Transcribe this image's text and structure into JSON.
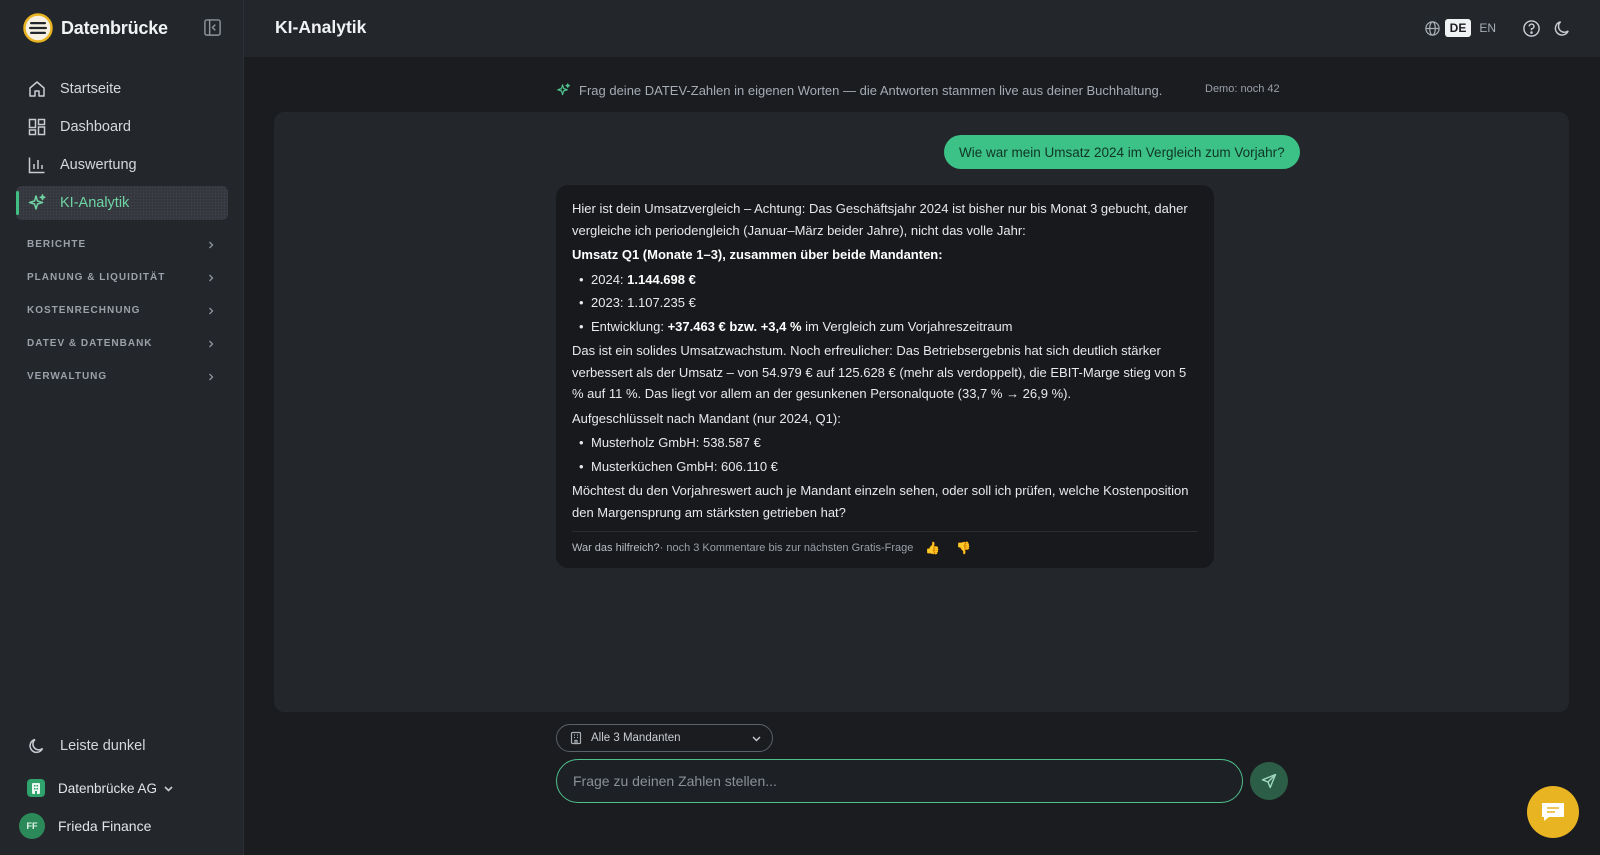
{
  "app": {
    "name": "Datenbrücke"
  },
  "nav": {
    "items": [
      {
        "label": "Startseite",
        "icon": "home-icon"
      },
      {
        "label": "Dashboard",
        "icon": "grid-icon"
      },
      {
        "label": "Auswertung",
        "icon": "bar-chart-icon"
      },
      {
        "label": "KI-Analytik",
        "icon": "sparkles-icon",
        "active": true
      }
    ],
    "sections": [
      "BERICHTE",
      "PLANUNG & LIQUIDITÄT",
      "KOSTENRECHNUNG",
      "DATEV & DATENBANK",
      "VERWALTUNG"
    ]
  },
  "sidebar_bottom": {
    "theme_toggle": "Leiste dunkel",
    "company": "Datenbrücke AG",
    "user_name": "Frieda Finance",
    "user_initials": "FF"
  },
  "header": {
    "title": "KI-Analytik",
    "lang_active": "DE",
    "lang_other": "EN"
  },
  "hint": {
    "text": "Frag deine DATEV-Zahlen in eigenen Worten — die Antworten stammen live aus deiner Buchhaltung.",
    "demo": "Demo: noch 42"
  },
  "chat": {
    "question": "Wie war mein Umsatz 2024 im Vergleich zum Vorjahr?",
    "answer": {
      "intro": "Hier ist dein Umsatzvergleich – Achtung: Das Geschäftsjahr 2024 ist bisher nur bis Monat 3 gebucht, daher vergleiche ich periodengleich (Januar–März beider Jahre), nicht das volle Jahr:",
      "heading": "Umsatz Q1 (Monate 1–3), zusammen über beide Mandanten:",
      "b1_label": "2024: ",
      "b1_value": "1.144.698 €",
      "b2": "2023: 1.107.235 €",
      "b3_label": "Entwicklung: ",
      "b3_value": "+37.463 € bzw. +3,4 %",
      "b3_tail": " im Vergleich zum Vorjahreszeitraum",
      "para2": "Das ist ein solides Umsatzwachstum. Noch erfreulicher: Das Betriebsergebnis hat sich deutlich stärker verbessert als der Umsatz – von 54.979 € auf 125.628 € (mehr als verdoppelt), die EBIT-Marge stieg von 5 % auf 11 %. Das liegt vor allem an der gesunkenen Personalquote (33,7 % → 26,9 %).",
      "para3": "Aufgeschlüsselt nach Mandant (nur 2024, Q1):",
      "m1": "Musterholz GmbH: 538.587 €",
      "m2": "Musterküchen GmbH: 606.110 €",
      "closing": "Möchtest du den Vorjahreswert auch je Mandant einzeln sehen, oder soll ich prüfen, welche Kostenposition den Margensprung am stärksten getrieben hat?",
      "feedback_q": "War das hilfreich?",
      "feedback_note": " · noch 3 Kommentare bis zur nächsten Gratis-Frage",
      "thumb_up": "👍",
      "thumb_down": "👎"
    }
  },
  "composer": {
    "mandant": "Alle 3 Mandanten",
    "placeholder": "Frage zu deinen Zahlen stellen..."
  },
  "colors": {
    "accent": "#3cc286",
    "fab": "#e9b422",
    "sidebar_bg": "#23262b",
    "main_bg": "#1a1c20"
  }
}
